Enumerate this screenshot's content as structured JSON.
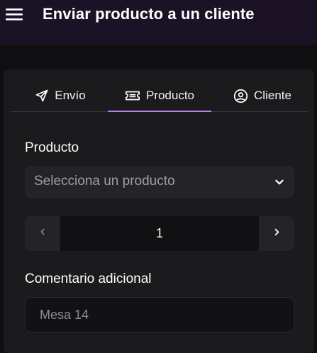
{
  "appbar": {
    "title": "Enviar producto a un cliente",
    "menu_icon": "hamburger-menu-icon"
  },
  "tabs": [
    {
      "label": "Envío",
      "icon": "send-icon",
      "active": false
    },
    {
      "label": "Producto",
      "icon": "ticket-icon",
      "active": true
    },
    {
      "label": "Cliente",
      "icon": "user-circle-icon",
      "active": false
    }
  ],
  "product": {
    "label": "Producto",
    "placeholder": "Selecciona un producto"
  },
  "quantity": {
    "value": "1"
  },
  "comment": {
    "label": "Comentario adicional",
    "placeholder": "Mesa 14"
  },
  "colors": {
    "accent": "#b083e8",
    "appbar_bg": "#1c1226",
    "card_bg": "#1b1b1e"
  }
}
